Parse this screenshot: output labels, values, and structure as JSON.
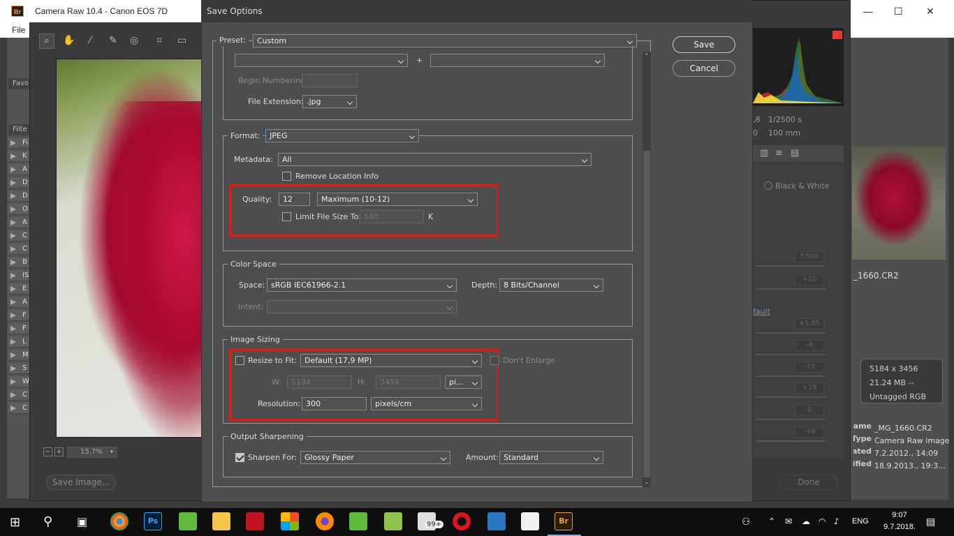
{
  "bridge": {
    "menu_file": "File",
    "logo": "Br",
    "sidebar_fav": "Favo",
    "sidebar_filter": "Filte",
    "sidebar_items": [
      "Fi",
      "K",
      "A",
      "D",
      "D",
      "O",
      "A",
      "C",
      "C",
      "B",
      "IS",
      "E",
      "A",
      "F",
      "F",
      "L",
      "M",
      "S",
      "W",
      "C",
      "C"
    ],
    "window_controls": {
      "minimize": "—",
      "maximize": "☐",
      "close": "✕"
    },
    "thumb_name": "_1660.CR2",
    "meta_box": {
      "dimensions": "5184 x 3456",
      "size": "21.24 MB  --",
      "color": "Untagged  RGB"
    },
    "meta_rows": [
      {
        "key": "Filename",
        "value": "_MG_1660.CR2"
      },
      {
        "key": "Type",
        "value": "Camera Raw image"
      },
      {
        "key": "Created",
        "value": "7.2.2012., 14:09"
      },
      {
        "key": "Modified",
        "value": "18.9.2013., 19:3..."
      }
    ]
  },
  "camera_raw": {
    "title": "Camera Raw 10.4  -  Canon EOS 7D",
    "zoom": "15,7%",
    "save_image": "Save Image...",
    "done": "Done",
    "shutter": "1/2500 s",
    "focal": "100 mm",
    "iso_frag": ",8",
    "iso_frag2": "0",
    "bw_label": "Black & White",
    "default_link": "fault",
    "right_values": [
      "5500",
      "+10",
      "+1,85",
      "-4",
      "-19",
      "+19",
      "0",
      "-39"
    ]
  },
  "dialog": {
    "title": "Save Options",
    "preset_label": "Preset:",
    "preset_value": "Custom",
    "plus": "+",
    "begin_numbering_label": "Begin Numbering:",
    "file_extension_label": "File Extension:",
    "file_extension_value": ".jpg",
    "format_label": "Format:",
    "format_value": "JPEG",
    "metadata_label": "Metadata:",
    "metadata_value": "All",
    "remove_location_label": "Remove Location Info",
    "quality_label": "Quality:",
    "quality_value": "12",
    "quality_preset": "Maximum  (10-12)",
    "limit_file_size_label": "Limit File Size To:",
    "limit_file_size_value": "500",
    "limit_unit": "K",
    "color_space_group": "Color Space",
    "space_label": "Space:",
    "space_value": "sRGB IEC61966-2.1",
    "depth_label": "Depth:",
    "depth_value": "8 Bits/Channel",
    "intent_label": "Intent:",
    "image_sizing_group": "Image Sizing",
    "resize_label": "Resize to Fit:",
    "resize_value": "Default  (17,9 MP)",
    "dont_enlarge_label": "Don't Enlarge",
    "w_label": "W:",
    "w_value": "5184",
    "h_label": "H:",
    "h_value": "3456",
    "size_unit": "pi...",
    "resolution_label": "Resolution:",
    "resolution_value": "300",
    "resolution_unit": "pixels/cm",
    "output_sharpening_group": "Output Sharpening",
    "sharpen_label": "Sharpen For:",
    "sharpen_value": "Glossy Paper",
    "amount_label": "Amount:",
    "amount_value": "Standard",
    "save_button": "Save",
    "cancel_button": "Cancel"
  },
  "taskbar": {
    "time": "9:07",
    "date": "9.7.2018.",
    "language": "ENG",
    "badge": "99+"
  }
}
